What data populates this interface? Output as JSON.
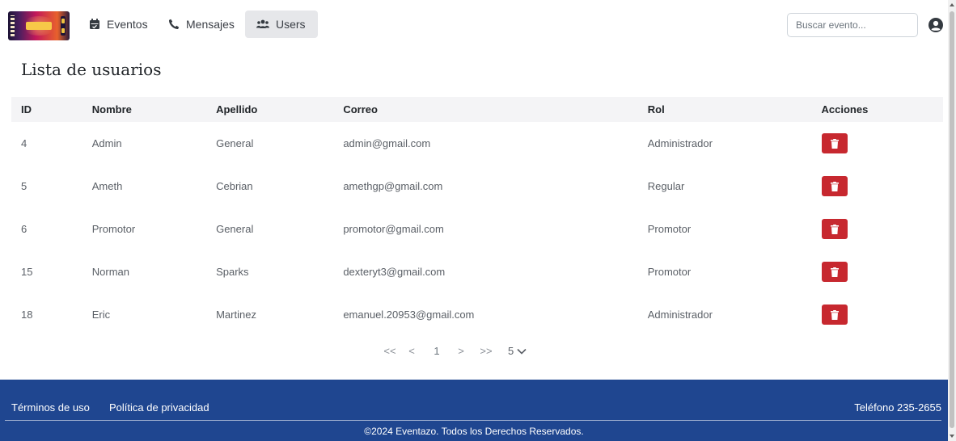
{
  "nav": {
    "items": [
      {
        "label": "Eventos",
        "icon": "calendar-icon"
      },
      {
        "label": "Mensajes",
        "icon": "phone-icon"
      },
      {
        "label": "Users",
        "icon": "users-icon",
        "active": true
      }
    ],
    "search_placeholder": "Buscar evento..."
  },
  "page": {
    "title": "Lista de usuarios"
  },
  "table": {
    "headers": [
      "ID",
      "Nombre",
      "Apellido",
      "Correo",
      "Rol",
      "Acciones"
    ],
    "rows": [
      {
        "id": "4",
        "nombre": "Admin",
        "apellido": "General",
        "correo": "admin@gmail.com",
        "rol": "Administrador"
      },
      {
        "id": "5",
        "nombre": "Ameth",
        "apellido": "Cebrian",
        "correo": "amethgp@gmail.com",
        "rol": "Regular"
      },
      {
        "id": "6",
        "nombre": "Promotor",
        "apellido": "General",
        "correo": "promotor@gmail.com",
        "rol": "Promotor"
      },
      {
        "id": "15",
        "nombre": "Norman",
        "apellido": "Sparks",
        "correo": "dexteryt3@gmail.com",
        "rol": "Promotor"
      },
      {
        "id": "18",
        "nombre": "Eric",
        "apellido": "Martinez",
        "correo": "emanuel.20953@gmail.com",
        "rol": "Administrador"
      }
    ]
  },
  "pagination": {
    "first": "<<",
    "prev": "<",
    "current_page": "1",
    "next": ">",
    "last": ">>",
    "page_size": "5"
  },
  "footer": {
    "terms": "Términos de uso",
    "privacy": "Política de privacidad",
    "phone": "Teléfono 235-2655",
    "copyright": "©2024 Eventazo. Todos los Derechos Reservados."
  },
  "colors": {
    "footer_bg": "#1f4690",
    "delete_button": "#c7282f",
    "active_nav_bg": "#e6e7ea"
  }
}
